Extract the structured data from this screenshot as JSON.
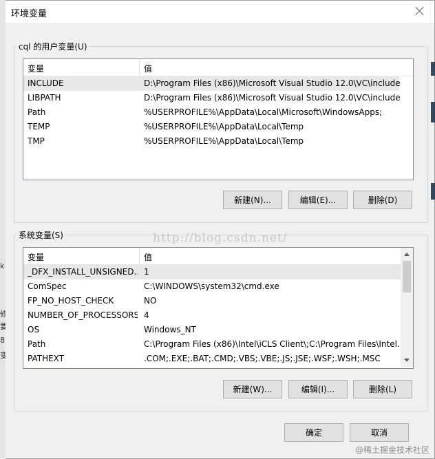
{
  "dialog": {
    "title": "环境变量",
    "ok_label": "确定",
    "cancel_label": "取消"
  },
  "user_vars": {
    "label": "cql 的用户变量(U)",
    "columns": [
      "变量",
      "值"
    ],
    "rows": [
      {
        "name": "INCLUDE",
        "value": "D:\\Program Files (x86)\\Microsoft Visual Studio 12.0\\VC\\include"
      },
      {
        "name": "LIBPATH",
        "value": "D:\\Program Files (x86)\\Microsoft Visual Studio 12.0\\VC\\include"
      },
      {
        "name": "Path",
        "value": "%USERPROFILE%\\AppData\\Local\\Microsoft\\WindowsApps;"
      },
      {
        "name": "TEMP",
        "value": "%USERPROFILE%\\AppData\\Local\\Temp"
      },
      {
        "name": "TMP",
        "value": "%USERPROFILE%\\AppData\\Local\\Temp"
      }
    ],
    "new_label": "新建(N)...",
    "edit_label": "编辑(E)...",
    "delete_label": "删除(D)"
  },
  "system_vars": {
    "label": "系统变量(S)",
    "columns": [
      "变量",
      "值"
    ],
    "rows": [
      {
        "name": "_DFX_INSTALL_UNSIGNED...",
        "value": "1"
      },
      {
        "name": "ComSpec",
        "value": "C:\\WINDOWS\\system32\\cmd.exe"
      },
      {
        "name": "FP_NO_HOST_CHECK",
        "value": "NO"
      },
      {
        "name": "NUMBER_OF_PROCESSORS",
        "value": "4"
      },
      {
        "name": "OS",
        "value": "Windows_NT"
      },
      {
        "name": "Path",
        "value": "C:\\Program Files (x86)\\Intel\\iCLS Client\\;C:\\Program Files\\Intel..."
      },
      {
        "name": "PATHEXT",
        "value": ".COM;.EXE;.BAT;.CMD;.VBS;.VBE;.JS;.JSE;.WSF;.WSH;.MSC"
      }
    ],
    "new_label": "新建(W)...",
    "edit_label": "编辑(I)...",
    "delete_label": "删除(L)"
  },
  "overlay": {
    "watermark": "http://blog.csdn.net/",
    "credit": "@稀土掘金技术社区"
  },
  "background_fragments": [
    "k",
    "修",
    "要",
    "8",
    "变"
  ],
  "icons": {
    "close": "close-icon",
    "scroll_up": "chevron-up-icon",
    "scroll_down": "chevron-down-icon"
  }
}
